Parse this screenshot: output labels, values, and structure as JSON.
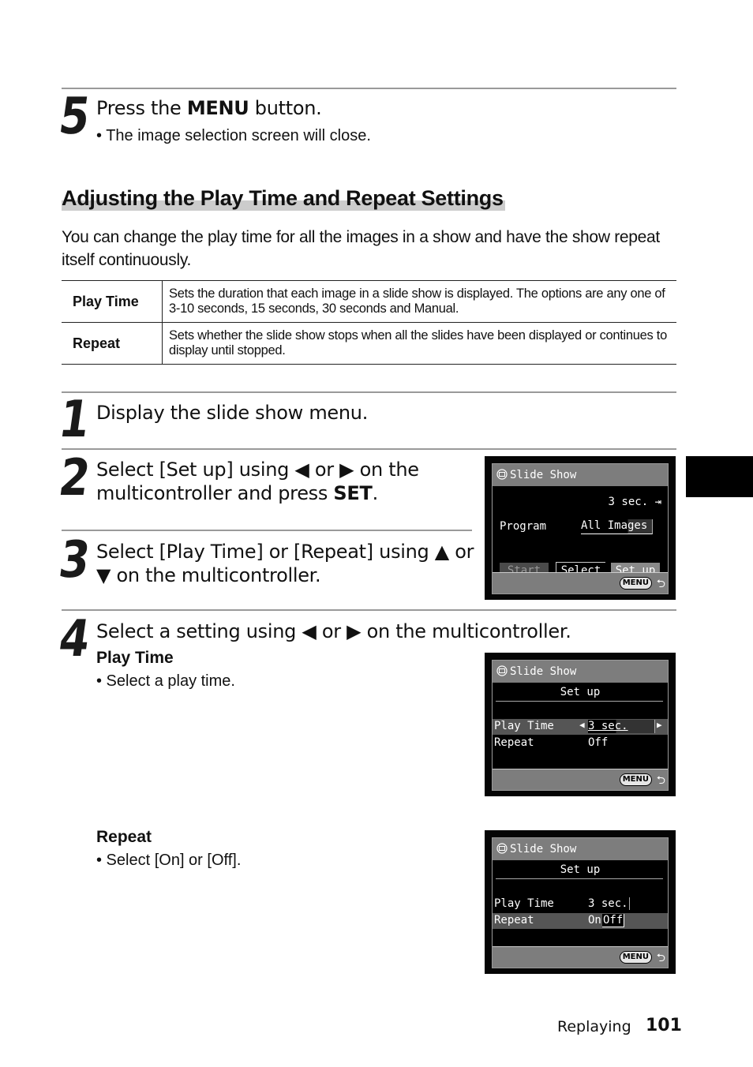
{
  "step5": {
    "number": "5",
    "text_before": "Press the ",
    "keyword": "MENU",
    "text_after": " button.",
    "bullet": "• The image selection screen will close."
  },
  "section": {
    "title": "Adjusting the Play Time and Repeat Settings",
    "intro": "You can change the play time for all the images in a show and have the show repeat itself continuously."
  },
  "settings_table": [
    {
      "name": "Play Time",
      "description": "Sets the duration that each image in a slide show is displayed. The options are any one of 3-10 seconds, 15 seconds, 30 seconds and Manual."
    },
    {
      "name": "Repeat",
      "description": "Sets whether the slide show stops when all the slides have been displayed or continues to display until stopped."
    }
  ],
  "step1": {
    "number": "1",
    "text": "Display the slide show menu."
  },
  "step2": {
    "number": "2",
    "line1": "Select [Set up] using ◀ or ▶ on the",
    "line2_before": "multicontroller and press ",
    "keyword": "SET",
    "line2_after": "."
  },
  "step3": {
    "number": "3",
    "line1": "Select [Play Time] or [Repeat] using ▲ or",
    "line2": "▼ on the multicontroller."
  },
  "step4": {
    "number": "4",
    "text": "Select a setting using ◀ or ▶ on the multicontroller.",
    "playtime_heading": "Play Time",
    "playtime_bullet": "• Select a play time.",
    "repeat_heading": "Repeat",
    "repeat_bullet": "• Select [On] or [Off]."
  },
  "screen1": {
    "title": "Slide Show",
    "time": "3 sec.",
    "time_icon": "⇥",
    "program_label": "Program",
    "program_value": "All Images",
    "buttons": [
      "Start",
      "Select",
      "Set up"
    ],
    "menu_label": "MENU",
    "back_icon": "⮌"
  },
  "screen2": {
    "title": "Slide Show",
    "header": "Set up",
    "rows": [
      {
        "label": "Play Time",
        "value": "3 sec."
      },
      {
        "label": "Repeat",
        "value": "Off"
      }
    ],
    "left_arrow": "◀",
    "right_arrow": "▶",
    "menu_label": "MENU",
    "back_icon": "⮌"
  },
  "screen3": {
    "title": "Slide Show",
    "header": "Set up",
    "rows": [
      {
        "label": "Play Time",
        "value": "3 sec."
      },
      {
        "label": "Repeat",
        "value_on": "On",
        "value_off": "Off"
      }
    ],
    "menu_label": "MENU",
    "back_icon": "⮌"
  },
  "footer": {
    "section": "Replaying",
    "page": "101"
  }
}
